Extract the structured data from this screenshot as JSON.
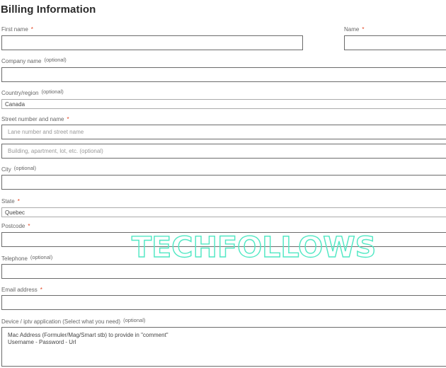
{
  "form": {
    "title": "Billing Information",
    "required_marker": "*",
    "optional_marker": "(optional)",
    "fields": {
      "first_name": {
        "label": "First name",
        "value": ""
      },
      "last_name": {
        "label": "Name",
        "value": ""
      },
      "company": {
        "label": "Company name",
        "value": ""
      },
      "country": {
        "label": "Country/region",
        "value": "Canada"
      },
      "street": {
        "label": "Street number and name",
        "placeholder_1": "Lane number and street name",
        "placeholder_2": "Building, apartment, lot, etc.  (optional)"
      },
      "city": {
        "label": "City",
        "value": ""
      },
      "state": {
        "label": "State",
        "value": "Quebec"
      },
      "postcode": {
        "label": "Postcode",
        "value": ""
      },
      "telephone": {
        "label": "Telephone",
        "value": ""
      },
      "email": {
        "label": "Email address",
        "value": ""
      },
      "device": {
        "label": "Device / iptv application (Select what you need)",
        "placeholder_line_1": "Mac Address (Formuler/Mag/Smart stb) to provide in \"comment\"",
        "placeholder_line_2": "Username - Password - Url"
      }
    }
  },
  "watermark": {
    "text": "TECHFOLLOWS",
    "color": "#52e8c4"
  },
  "colors": {
    "required": "#e2401c",
    "border": "#6b6b6b",
    "label": "#666666"
  }
}
